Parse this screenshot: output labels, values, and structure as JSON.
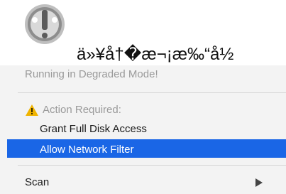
{
  "header": {
    "garbled_text": "ä»¥å†�æ¬¡æ‰“å½"
  },
  "menu": {
    "degraded_label": "Running in Degraded Mode!",
    "action_required_label": "Action Required:",
    "grant_access_label": "Grant Full Disk Access",
    "allow_filter_label": "Allow Network Filter",
    "scan_label": "Scan"
  },
  "colors": {
    "selection": "#1a66e6",
    "warning": "#f0b400",
    "menu_background": "#f3f3f3"
  },
  "icons": {
    "app": "lulu-app-icon",
    "warning": "warning-icon",
    "submenu": "submenu-arrow-icon"
  }
}
